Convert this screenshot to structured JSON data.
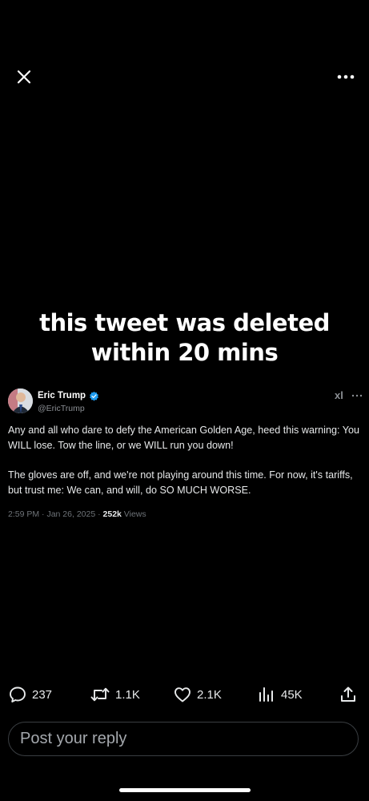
{
  "top_bar": {
    "close_icon": "close-icon",
    "more_icon": "more-horizontal-icon"
  },
  "caption": {
    "line1": "this tweet was deleted",
    "line2": "within 20 mins"
  },
  "tweet": {
    "author_name": "Eric Trump",
    "handle": "@EricTrump",
    "verified": true,
    "brand_logo": "xl",
    "paragraph1": "Any and all who dare to defy the American Golden Age, heed this warning: You WILL lose. Tow the line, or we WILL run you down!",
    "paragraph2": "The gloves are off, and we're not playing around this time. For now, it's tariffs, but trust me: We can, and will, do SO MUCH WORSE.",
    "time": "2:59 PM",
    "date": "Jan 26, 2025",
    "views_count": "252k",
    "views_label": "Views"
  },
  "actions": {
    "replies": "237",
    "reposts": "1.1K",
    "likes": "2.1K",
    "views": "45K"
  },
  "reply_input": {
    "placeholder": "Post your reply"
  },
  "colors": {
    "background": "#000000",
    "verified": "#1d9bf0",
    "muted": "#8b8f94"
  }
}
